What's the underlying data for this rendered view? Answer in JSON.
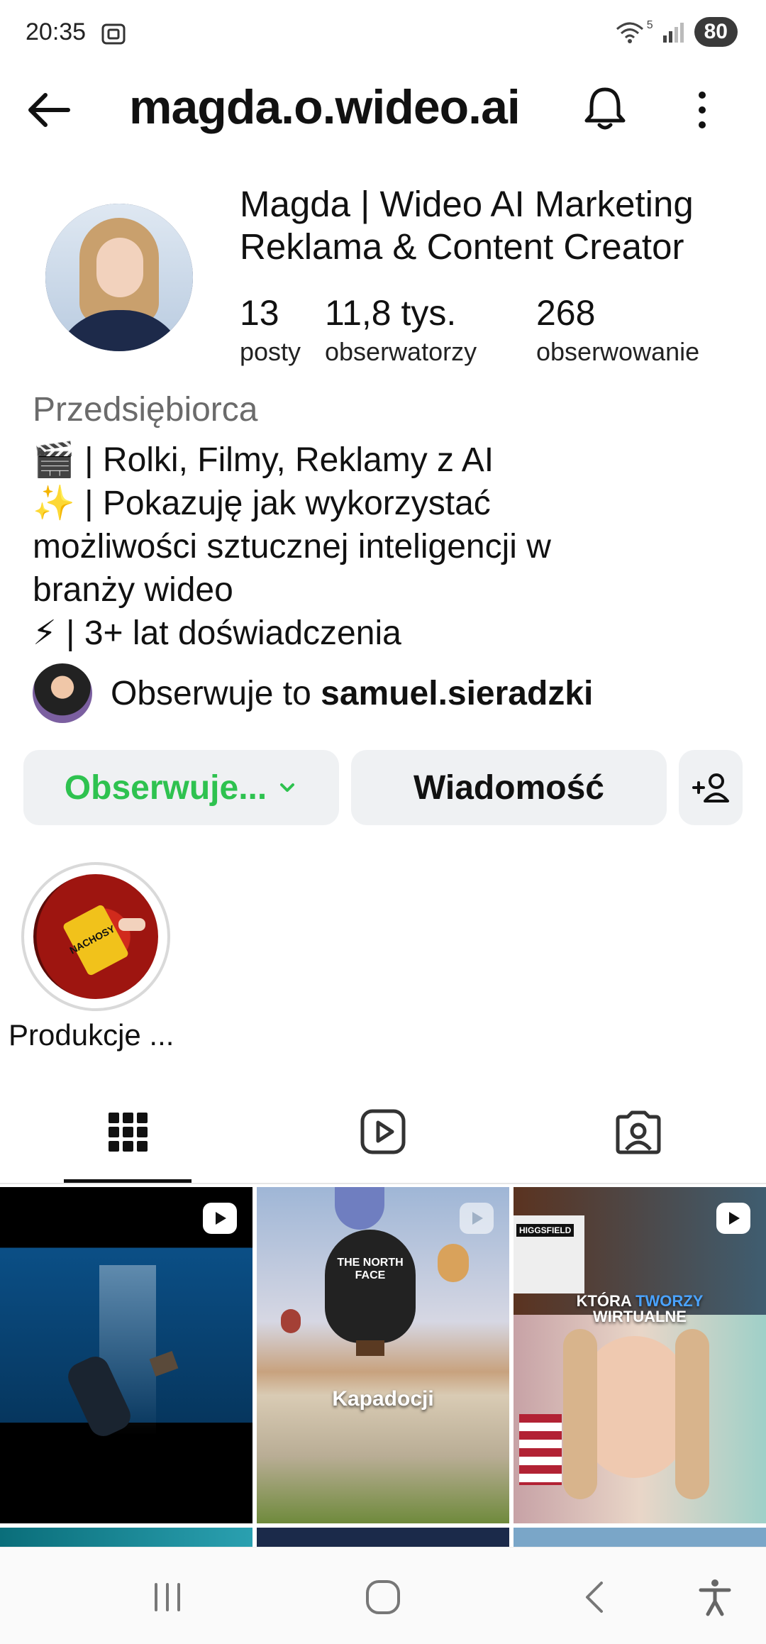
{
  "status_bar": {
    "time": "20:35",
    "battery": "80",
    "network": "5"
  },
  "header": {
    "username": "magda.o.wideo.ai"
  },
  "profile": {
    "full_name_line1": "Magda | Wideo AI Marketing",
    "full_name_line2": "Reklama & Content Creator",
    "stats": {
      "posts_value": "13",
      "posts_label": "posty",
      "followers_value": "11,8 tys.",
      "followers_label": "obserwatorzy",
      "following_value": "268",
      "following_label": "obserwowanie"
    },
    "category": "Przedsiębiorca",
    "bio": [
      "🎬 | Rolki, Filmy, Reklamy z AI",
      "✨ | Pokazuję jak wykorzystać",
      "możliwości sztucznej inteligencji w",
      "branży wideo",
      "⚡ | 3+ lat doświadczenia"
    ],
    "followed_by_prefix": "Obserwuje to ",
    "followed_by_user": "samuel.sieradzki"
  },
  "actions": {
    "following_label": "Obserwuje...",
    "message_label": "Wiadomość"
  },
  "highlights": [
    {
      "label": "Produkcje ..."
    }
  ],
  "highlight_image_text": "NACHOSY",
  "tabs": [
    {
      "icon": "grid-icon",
      "active": true
    },
    {
      "icon": "reels-icon",
      "active": false
    },
    {
      "icon": "tagged-icon",
      "active": false
    }
  ],
  "posts": [
    {
      "caption": "",
      "reel": true
    },
    {
      "caption": "Kapadocji",
      "reel": true,
      "overlay_text": "THE NORTH FACE"
    },
    {
      "caption": "KTÓRA TWORZY WIRTUALNE",
      "caption_part1": "KTÓRA",
      "caption_part2": "TWORZY",
      "caption_part3": "WIRTUALNE",
      "reel": true,
      "overlay_text": "HIGGSFIELD"
    }
  ],
  "colors": {
    "follow_green": "#2ec24f",
    "button_bg": "#eff1f3"
  }
}
